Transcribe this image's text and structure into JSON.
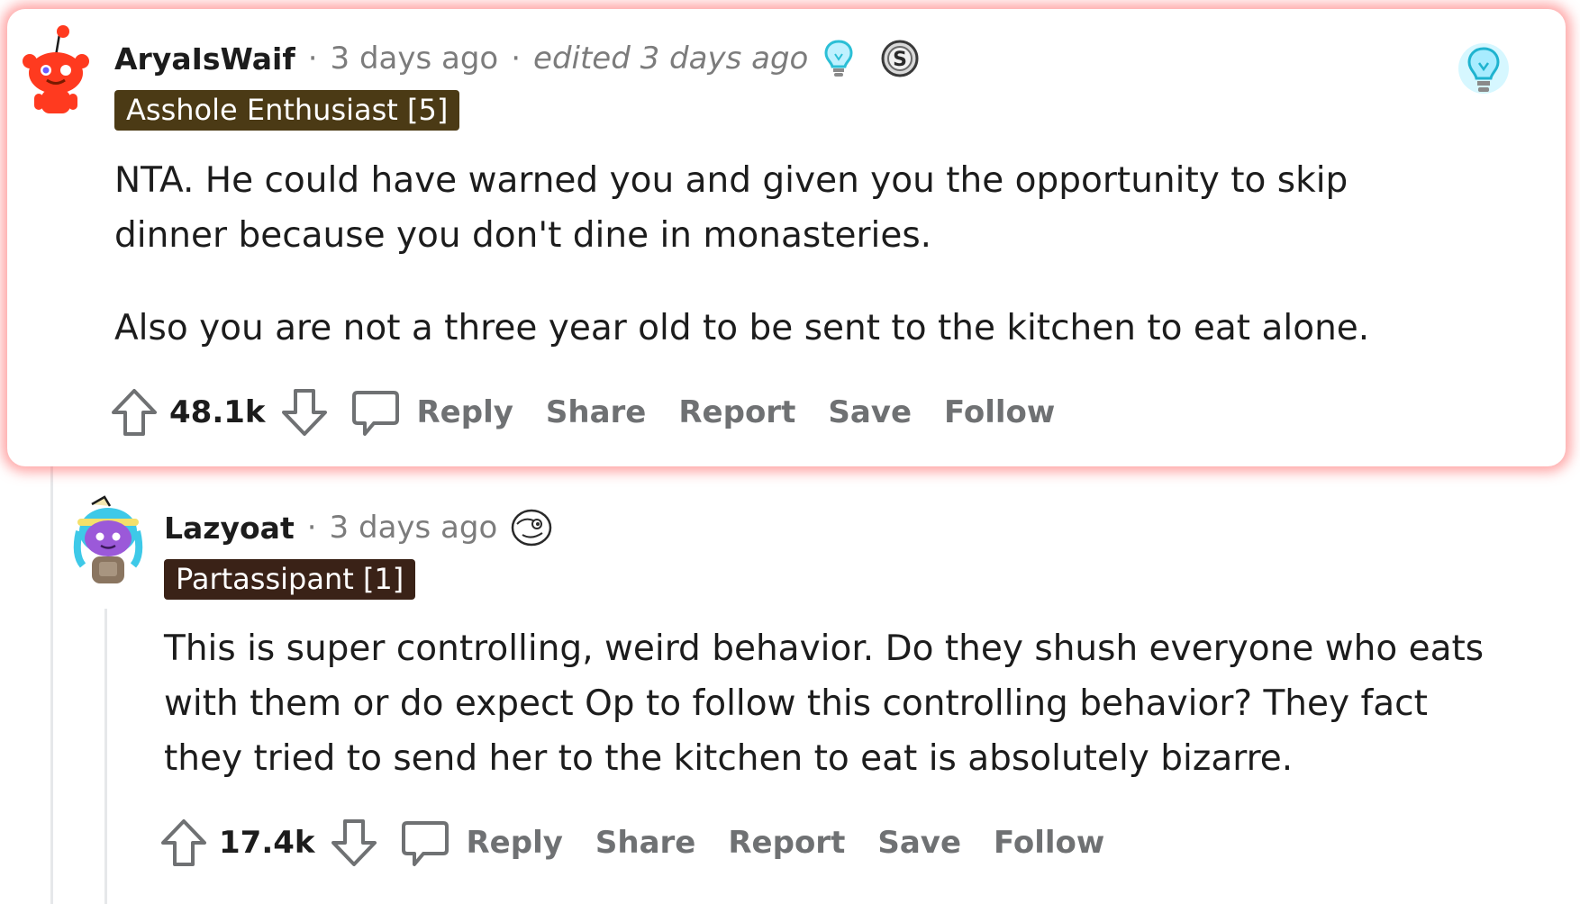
{
  "comments": [
    {
      "username": "AryaIsWaif",
      "time": "3 days ago",
      "edited": "edited 3 days ago",
      "flair": "Asshole Enthusiast [5]",
      "paragraphs": [
        "NTA. He could have warned you and given you the opportunity to skip dinner because you don't dine in monasteries.",
        "Also you are not a three year old to be sent to the kitchen to eat alone."
      ],
      "score": "48.1k",
      "actions": {
        "reply": "Reply",
        "share": "Share",
        "report": "Report",
        "save": "Save",
        "follow": "Follow"
      },
      "awards": [
        "lightbulb-icon",
        "silver-coin-icon"
      ],
      "highlighted": true,
      "highlight_color": "#ff5a5a"
    },
    {
      "username": "Lazyoat",
      "time": "3 days ago",
      "flair": "Partassipant [1]",
      "paragraphs": [
        "This is super controlling, weird behavior. Do they shush everyone who eats with them or do expect Op to follow this controlling behavior? They fact they tried to send her to the kitchen to eat is absolutely bizarre."
      ],
      "score": "17.4k",
      "actions": {
        "reply": "Reply",
        "share": "Share",
        "report": "Report",
        "save": "Save",
        "follow": "Follow"
      },
      "awards": [
        "face-emoji-icon"
      ]
    }
  ],
  "colors": {
    "flair_bg": "#4b3a15",
    "flair_bg_2": "#3a2217",
    "snoo_red": "#ff3a1f",
    "action_gray": "#6f7173"
  }
}
